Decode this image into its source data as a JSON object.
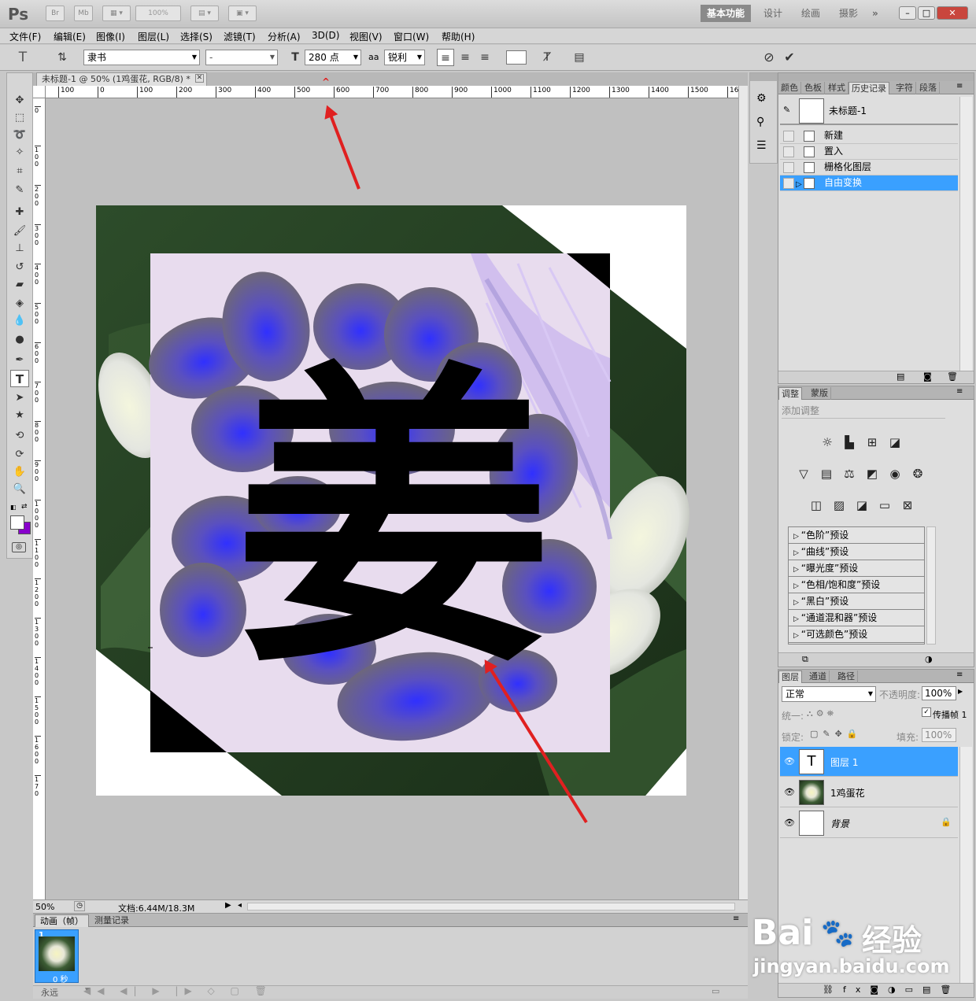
{
  "app": {
    "logo": "Ps",
    "zoom_combo": "100%",
    "workspaces": [
      "基本功能",
      "设计",
      "绘画",
      "摄影"
    ],
    "overflow": "»"
  },
  "menu": [
    "文件(F)",
    "编辑(E)",
    "图像(I)",
    "图层(L)",
    "选择(S)",
    "滤镜(T)",
    "分析(A)",
    "3D(D)",
    "视图(V)",
    "窗口(W)",
    "帮助(H)"
  ],
  "options": {
    "font_family": "隶书",
    "font_style": "-",
    "font_size": "280 点",
    "aa_label": "aa",
    "antialias": "锐利"
  },
  "document": {
    "tab_title": "未标题-1 @ 50% (1鸡蛋花, RGB/8) *",
    "text_glyph": "姜",
    "ruler_labels": [
      "100",
      "0",
      "100",
      "200",
      "300",
      "400",
      "500",
      "600",
      "700",
      "800",
      "900",
      "1000",
      "1100",
      "1200",
      "1300",
      "1400",
      "1500",
      "160"
    ],
    "vruler_labels": [
      "0",
      "1 0 0",
      "2 0 0",
      "3 0 0",
      "4 0 0",
      "5 0 0",
      "6 0 0",
      "7 0 0",
      "8 0 0",
      "9 0 0",
      "1 0 0 0",
      "1 1 0 0",
      "1 2 0 0",
      "1 3 0 0",
      "1 4 0 0",
      "1 5 0 0",
      "1 6 0 0",
      "1 7 0"
    ]
  },
  "status": {
    "zoom": "50%",
    "doc_info": "文档:6.44M/18.3M"
  },
  "animation": {
    "tabs": [
      "动画（帧）",
      "测量记录"
    ],
    "frame_number": "1",
    "frame_delay": "0 秒",
    "loop": "永远"
  },
  "history": {
    "tabs": [
      "颜色",
      "色板",
      "样式",
      "历史记录",
      "字符",
      "段落"
    ],
    "snapshot": "未标题-1",
    "items": [
      "新建",
      "置入",
      "栅格化图层",
      "自由变换"
    ],
    "selected_index": 3
  },
  "adjustments": {
    "tabs": [
      "调整",
      "蒙版"
    ],
    "heading": "添加调整",
    "presets": [
      "“色阶”预设",
      "“曲线”预设",
      "“曝光度”预设",
      "“色相/饱和度”预设",
      "“黑白”预设",
      "“通道混和器”预设",
      "“可选颜色”预设"
    ]
  },
  "layers": {
    "tabs": [
      "图层",
      "通道",
      "路径"
    ],
    "blend_mode": "正常",
    "opacity_label": "不透明度:",
    "opacity": "100%",
    "unify_label": "统一:",
    "propagate_label": "传播帧 1",
    "lock_label": "锁定:",
    "fill_label": "填充:",
    "fill": "100%",
    "items": [
      {
        "name": "图层 1",
        "type": "text",
        "thumb_glyph": "T"
      },
      {
        "name": "1鸡蛋花",
        "type": "image"
      },
      {
        "name": "背景",
        "type": "background"
      }
    ]
  },
  "watermark": {
    "brand": "Bai",
    "brand_cn": "经验",
    "url": "jingyan.baidu.com"
  },
  "colors": {
    "selection_blue": "#3aa0ff",
    "arrow_red": "#e02020",
    "background_color_swatch": "#8800cc"
  }
}
